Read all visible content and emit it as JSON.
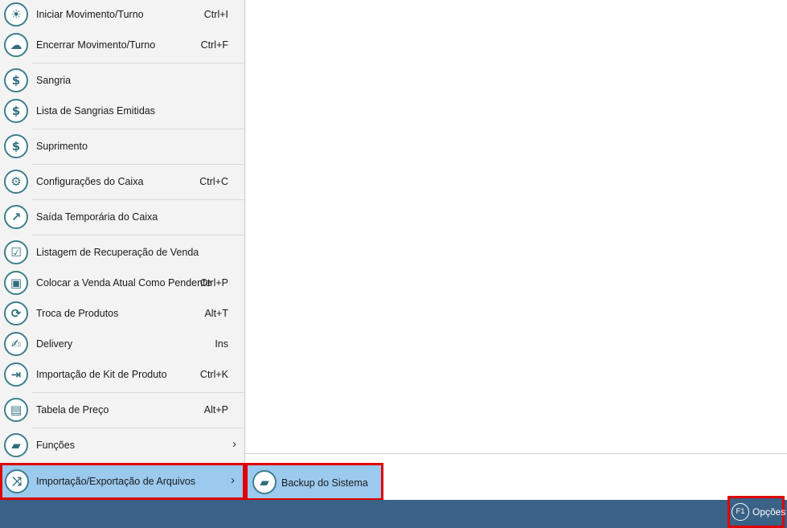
{
  "menu": {
    "items": [
      {
        "icon": "sun-icon",
        "glyph": "☀",
        "label": "Iniciar Movimento/Turno",
        "shortcut": "Ctrl+I"
      },
      {
        "icon": "cloud-sun-icon",
        "glyph": "☁",
        "label": "Encerrar Movimento/Turno",
        "shortcut": "Ctrl+F"
      },
      {
        "icon": "dollar-minus-icon",
        "glyph": "$",
        "label": "Sangria",
        "shortcut": ""
      },
      {
        "icon": "dollar-minus-list-icon",
        "glyph": "$",
        "label": "Lista de Sangrias Emitidas",
        "shortcut": ""
      },
      {
        "icon": "dollar-plus-icon",
        "glyph": "$",
        "label": "Suprimento",
        "shortcut": ""
      },
      {
        "icon": "gear-icon",
        "glyph": "⚙",
        "label": "Configurações do Caixa",
        "shortcut": "Ctrl+C"
      },
      {
        "icon": "exit-register-icon",
        "glyph": "↗",
        "label": "Saída Temporária do Caixa",
        "shortcut": ""
      },
      {
        "icon": "checklist-icon",
        "glyph": "☑",
        "label": "Listagem de Recuperação de Venda",
        "shortcut": ""
      },
      {
        "icon": "pending-sale-icon",
        "glyph": "▣",
        "label": "Colocar a Venda Atual Como Pendente",
        "shortcut": "Ctrl+P"
      },
      {
        "icon": "exchange-icon",
        "glyph": "⟳",
        "label": "Troca de Produtos",
        "shortcut": "Alt+T"
      },
      {
        "icon": "delivery-icon",
        "glyph": "✍",
        "label": "Delivery",
        "shortcut": "Ins"
      },
      {
        "icon": "import-kit-icon",
        "glyph": "⇥",
        "label": "Importação de Kit de Produto",
        "shortcut": "Ctrl+K"
      },
      {
        "icon": "price-table-icon",
        "glyph": "▤",
        "label": "Tabela de Preço",
        "shortcut": "Alt+P"
      },
      {
        "icon": "functions-folder-icon",
        "glyph": "▰",
        "label": "Funções",
        "shortcut": ""
      },
      {
        "icon": "shuffle-icon",
        "glyph": "⤨",
        "label": "Importação/Exportação de Arquivos",
        "shortcut": ""
      }
    ]
  },
  "submenu": {
    "icon": "backup-folder-icon",
    "glyph": "▰",
    "label": "Backup do Sistema"
  },
  "statusbar": {
    "options_key": "F1",
    "options_label": "Opções"
  },
  "colors": {
    "accent": "#3a6186",
    "highlight": "#9cc9ee",
    "callout": "#e00000",
    "icon": "#3f7f8c"
  }
}
